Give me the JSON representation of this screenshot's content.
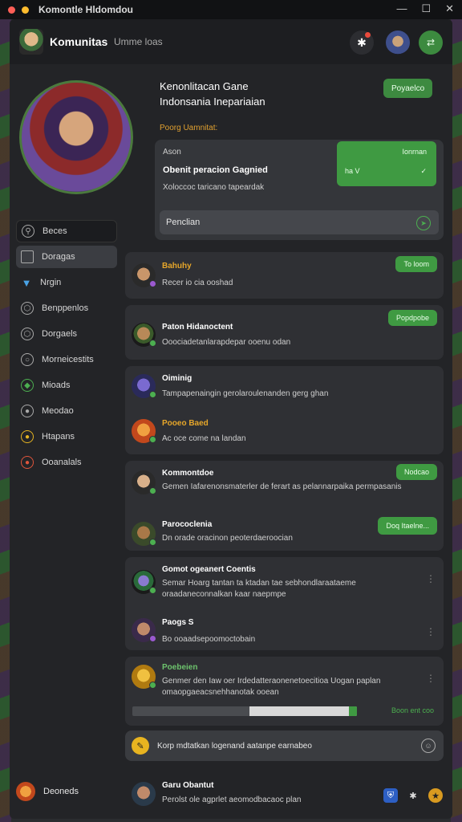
{
  "window": {
    "title": "Komontle Hldomdou"
  },
  "app": {
    "name": "Komunitas",
    "subtitle": "Umme️ loas"
  },
  "hero": {
    "title_line1": "Kenonlitacan Gane",
    "title_line2": "Indonsania Inepariaian",
    "pill": "Poyaelco",
    "section_label": "Poorg Uamnitat:"
  },
  "featured": {
    "small": "Ason",
    "headline": "Obenit peracion Gagnied",
    "text": "Xoloccoc taricano tapeardak",
    "green_top": "Ionrnan",
    "green_left": "ha   V",
    "green_right": "✓",
    "input_label": "Penclian"
  },
  "nav": {
    "search": "Beces",
    "items": [
      {
        "label": "Doragas",
        "icon": "square-icon"
      },
      {
        "label": "Nrgin",
        "icon": "fox-icon"
      },
      {
        "label": "Benppenlos",
        "icon": "hex-icon"
      },
      {
        "label": "Dorgaels",
        "icon": "hex2-icon"
      },
      {
        "label": "Morneicestits",
        "icon": "circle-icon"
      },
      {
        "label": "Mioads",
        "icon": "shield-icon"
      },
      {
        "label": "Meodao",
        "icon": "speaker-icon"
      },
      {
        "label": "Htapans",
        "icon": "coin-icon"
      },
      {
        "label": "Ooanalals",
        "icon": "flame-icon"
      }
    ]
  },
  "posts": [
    {
      "name": "Bahuhy",
      "text": "Recer io cia ooshad",
      "button": "To loom"
    },
    {
      "name": "Paton Hidanoctent",
      "text": "Ooociadetanlarapdepar ooenu odan",
      "button": "Popdpobe"
    },
    {
      "name": "Oiminig",
      "text": "Tampapenaingin gerolaroulenanden gerg ghan"
    },
    {
      "name": "Pooeo Baed",
      "text": "Ac oce come na landan"
    },
    {
      "name": "Kommontdoe",
      "text": "Gemen Iafarenonsmaterler de ferart as pelannarpaika permpasanis",
      "button": "Nodcao"
    },
    {
      "name": "Parococlenia",
      "text": "Dn orade oracinon peoterdaeroocian",
      "button": "Doq Itaelne..."
    },
    {
      "name": "Gomot ogeanert Coentis",
      "text": "Semar Hoarg tantan ta ktadan tae sebhondlaraataeme oraadaneconnalkan kaar naepmpe"
    },
    {
      "name": "Paogs S",
      "text": "Bo ooaadsepoomoctobain"
    },
    {
      "name": "Poebeien",
      "text": "Genmer den Iaw oer Irdedatteraonenetoecitioa Uogan paplan omaopgaeacsnehhanotak ooean",
      "progress_label": "Boon ent coo",
      "progress": 0.48
    }
  ],
  "composer": {
    "text": "Korp mdtatkan logenand aatanpe earnabeo"
  },
  "footer": {
    "user": "Deoneds",
    "bar_name": "Garu Obantut",
    "bar_text": "Perolst ole agprlet aeomodbacaoc plan"
  }
}
